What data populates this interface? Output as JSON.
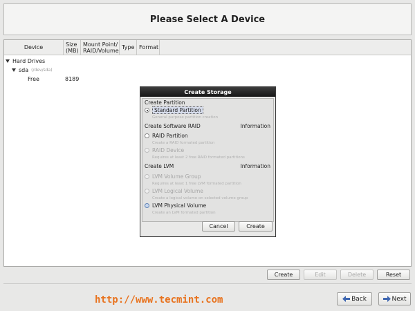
{
  "header": {
    "title": "Please Select A Device"
  },
  "tree": {
    "columns": [
      "Device",
      "Size (MB)",
      "Mount Point/ RAID/Volume",
      "Type",
      "Format"
    ],
    "root": {
      "label": "Hard Drives"
    },
    "disk": {
      "label": "sda",
      "path": "(/dev/sda)"
    },
    "free": {
      "label": "Free",
      "size": "8189"
    }
  },
  "dialog": {
    "title": "Create Storage",
    "partition_header": "Create Partition",
    "standard_label": "Standard Partition",
    "standard_desc": "General purpose partition creation",
    "raid_header": "Create Software RAID",
    "raid_info": "Information",
    "raid_partition_label": "RAID Partition",
    "raid_partition_desc": "Create a RAID formated partition",
    "raid_device_label": "RAID Device",
    "raid_device_desc": "Requires at least 2 free RAID formated partitions",
    "lvm_header": "Create LVM",
    "lvm_info": "Information",
    "lvm_vg_label": "LVM Volume Group",
    "lvm_vg_desc": "Requires at least 1 free LVM formated partition",
    "lvm_lv_label": "LVM Logical Volume",
    "lvm_lv_desc": "Create a logical volume on selected volume group",
    "lvm_pv_label": "LVM Physical Volume",
    "lvm_pv_desc": "Create an LVM formated partition",
    "cancel_label": "Cancel",
    "create_label": "Create"
  },
  "actions": {
    "create": "Create",
    "edit": "Edit",
    "delete": "Delete",
    "reset": "Reset"
  },
  "nav": {
    "back": "Back",
    "next": "Next"
  },
  "watermark": "http://www.tecmint.com"
}
